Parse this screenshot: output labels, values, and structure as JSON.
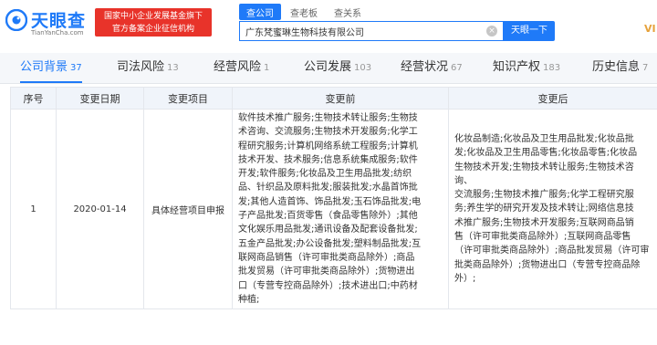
{
  "brand": {
    "name": "天眼查",
    "domain": "TianYanCha.com",
    "gov_line1": "国家中小企业发展基金旗下",
    "gov_line2": "官方备案企业征信机构"
  },
  "search": {
    "tabs": [
      {
        "label": "查公司",
        "active": true
      },
      {
        "label": "查老板",
        "active": false
      },
      {
        "label": "查关系",
        "active": false
      }
    ],
    "value": "广东梵蜜琳生物科技有限公司",
    "button_label": "天眼一下",
    "vip_label": "VI"
  },
  "nav_tabs": [
    {
      "label": "公司背景",
      "count": "37",
      "active": true
    },
    {
      "label": "司法风险",
      "count": "13",
      "active": false
    },
    {
      "label": "经营风险",
      "count": "1",
      "active": false
    },
    {
      "label": "公司发展",
      "count": "103",
      "active": false
    },
    {
      "label": "经营状况",
      "count": "67",
      "active": false
    },
    {
      "label": "知识产权",
      "count": "183",
      "active": false
    },
    {
      "label": "历史信息",
      "count": "7",
      "active": false
    }
  ],
  "table": {
    "headers": [
      "序号",
      "变更日期",
      "变更项目",
      "变更前",
      "变更后"
    ],
    "rows": [
      {
        "index": "1",
        "date": "2020-01-14",
        "item": "具体经营项目申报",
        "before_lines": [
          "软件技术推广服务;生物技术转让服务;生物技",
          "术咨询、交流服务;生物技术开发服务;化学工",
          "程研究服务;计算机网络系统工程服务;计算机",
          "技术开发、技术服务;信息系统集成服务;软件",
          "开发;软件服务;化妆品及卫生用品批发;纺织",
          "品、针织品及原料批发;服装批发;水晶首饰批",
          "发;其他人造首饰、饰品批发;玉石饰品批发;电",
          "子产品批发;百货零售（食品零售除外）;其他",
          "文化娱乐用品批发;通讯设备及配套设备批发;",
          "五金产品批发;办公设备批发;塑料制品批发;互",
          "联网商品销售（许可审批类商品除外）;商品",
          "批发贸易（许可审批类商品除外）;货物进出",
          "口（专营专控商品除外）;技术进出口;中药材",
          "种植;"
        ],
        "after_lines": [
          "化妆品制造;化妆品及卫生用品批发;化妆品批",
          "发;化妆品及卫生用品零售;化妆品零售;化妆品",
          "生物技术开发;生物技术转让服务;生物技术咨询、",
          "交流服务;生物技术推广服务;化学工程研究服",
          "务;养生学的研究开发及技术转让;网络信息技",
          "术推广服务;生物技术开发服务;互联网商品销",
          "售（许可审批类商品除外）;互联网商品零售",
          "（许可审批类商品除外）;商品批发贸易（许可审",
          "批类商品除外）;货物进出口（专营专控商品除",
          "外）;"
        ]
      }
    ]
  }
}
